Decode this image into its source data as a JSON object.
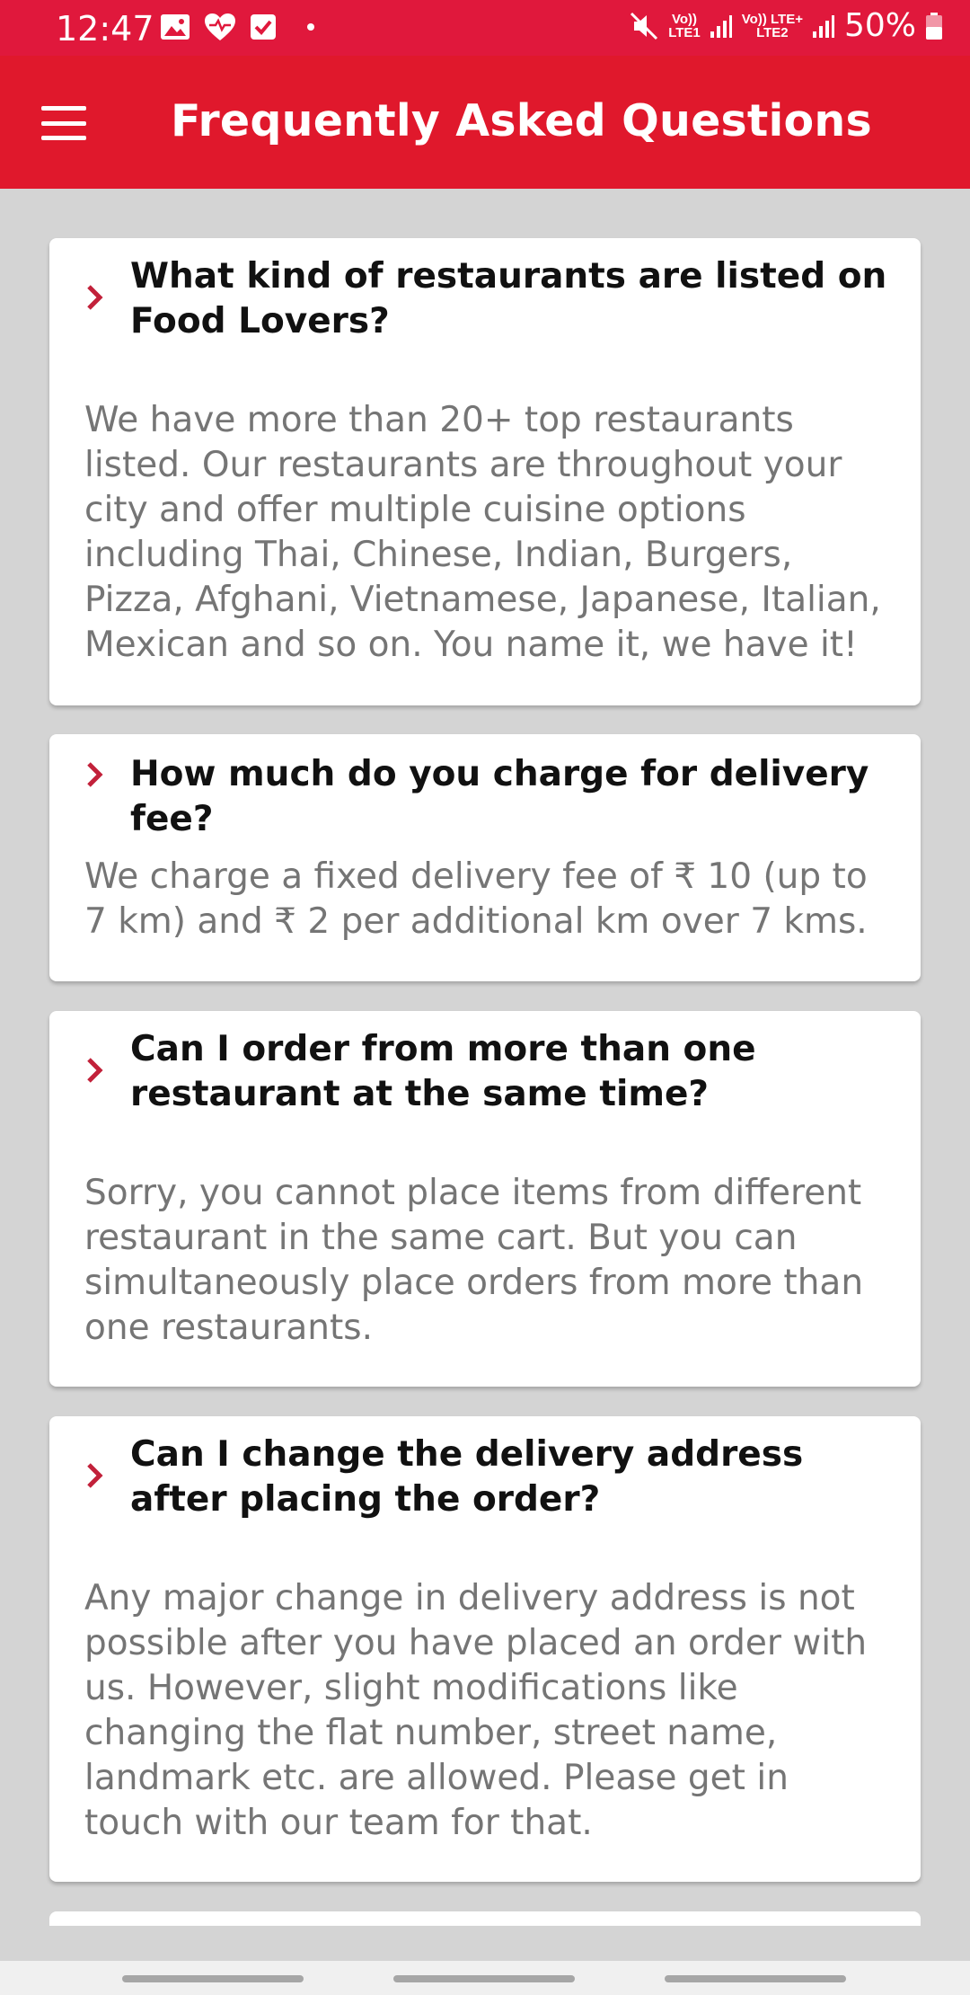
{
  "status_bar": {
    "time": "12:47",
    "left_icons": [
      "image-icon",
      "heart-icon",
      "checkbox-icon"
    ],
    "sim1_top": "Vo))",
    "sim1_bottom": "LTE1",
    "sim2_top": "Vo)) LTE+",
    "sim2_bottom": "LTE2",
    "battery_text": "50%"
  },
  "app_bar": {
    "title": "Frequently Asked Questions",
    "menu_icon": "menu-icon"
  },
  "colors": {
    "accent": "#e0182c",
    "status_bar": "#e0183c",
    "chevron": "#c2213a",
    "question_text": "#111111",
    "answer_text": "#757575",
    "background": "#d4d4d4"
  },
  "faqs": [
    {
      "question": "What kind of restaurants are listed on Food Lovers?",
      "answer": "We have more than 20+ top restaurants listed. Our restaurants are throughout your city and offer multiple cuisine options including Thai, Chinese, Indian, Burgers, Pizza, Afghani, Vietnamese, Japanese, Italian, Mexican and so on. You name it, we have it!"
    },
    {
      "question": "How much do you charge for delivery fee?",
      "answer": "We charge a fixed delivery fee of ₹ 10 (up to 7 km) and ₹ 2 per additional km over 7 kms."
    },
    {
      "question": "Can I order from more than one restaurant at the same time?",
      "answer": "Sorry, you cannot place items from different restaurant in the same cart. But you can simultaneously place orders from more than one restaurants."
    },
    {
      "question": "Can I change the delivery address after placing the order?",
      "answer": "Any major change in delivery address is not possible after you have placed an order with us. However, slight modifications like changing the flat number, street name, landmark etc. are allowed. Please get in touch with our team for that."
    }
  ]
}
